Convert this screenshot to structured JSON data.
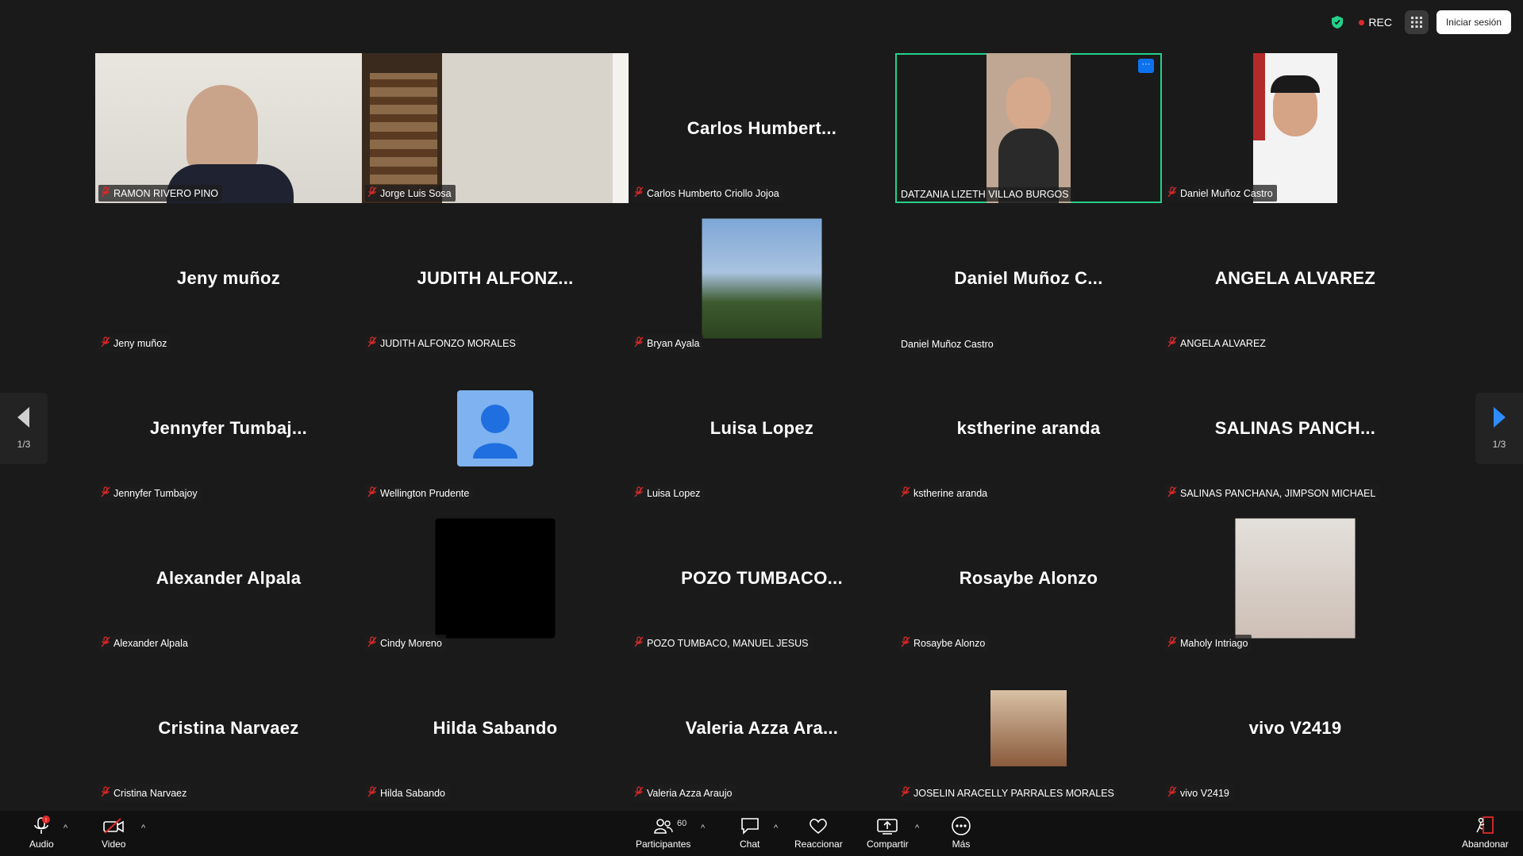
{
  "topbar": {
    "rec_label": "REC",
    "signin_label": "Iniciar sesión",
    "colors": {
      "shield": "#23d18b",
      "rec_dot": "#e02828"
    }
  },
  "pager": {
    "left_page": "1/3",
    "right_page": "1/3"
  },
  "tiles": [
    {
      "label": "RAMON RIVERO PINO",
      "big": "",
      "kind": "video",
      "muted": true
    },
    {
      "label": "Jorge Luis Sosa",
      "big": "",
      "kind": "video",
      "muted": true
    },
    {
      "label": "Carlos Humberto Criollo Jojoa",
      "big": "Carlos  Humbert...",
      "kind": "name",
      "muted": true
    },
    {
      "label": "DATZANIA LIZETH VILLAO BURGOS",
      "big": "",
      "kind": "video",
      "muted": false,
      "active": true
    },
    {
      "label": "Daniel Muñoz Castro",
      "big": "",
      "kind": "video",
      "muted": true
    },
    {
      "label": "Jeny muñoz",
      "big": "Jeny muñoz",
      "kind": "name",
      "muted": true
    },
    {
      "label": "JUDITH ALFONZO MORALES",
      "big": "JUDITH  ALFONZ...",
      "kind": "name",
      "muted": true
    },
    {
      "label": "Bryan Ayala",
      "big": "",
      "kind": "photo",
      "muted": true
    },
    {
      "label": "Daniel Muñoz Castro",
      "big": "Daniel  Muñoz  C...",
      "kind": "name",
      "muted": false
    },
    {
      "label": "ANGELA ALVAREZ",
      "big": "ANGELA ALVAREZ",
      "kind": "name",
      "muted": true
    },
    {
      "label": "Jennyfer Tumbajoy",
      "big": "Jennyfer  Tumbaj...",
      "kind": "name",
      "muted": true
    },
    {
      "label": "Wellington Prudente",
      "big": "",
      "kind": "generic",
      "muted": true
    },
    {
      "label": "Luisa Lopez",
      "big": "Luisa Lopez",
      "kind": "name",
      "muted": true
    },
    {
      "label": "kstherine aranda",
      "big": "kstherine aranda",
      "kind": "name",
      "muted": true
    },
    {
      "label": "SALINAS PANCHANA, JIMPSON MICHAEL",
      "big": "SALINAS  PANCH...",
      "kind": "name",
      "muted": true
    },
    {
      "label": "Alexander Alpala",
      "big": "Alexander Alpala",
      "kind": "name",
      "muted": true
    },
    {
      "label": "Cindy Moreno",
      "big": "",
      "kind": "black",
      "muted": true
    },
    {
      "label": "POZO TUMBACO, MANUEL JESUS",
      "big": "POZO  TUMBACO...",
      "kind": "name",
      "muted": true
    },
    {
      "label": "Rosaybe Alonzo",
      "big": "Rosaybe Alonzo",
      "kind": "name",
      "muted": true
    },
    {
      "label": "Maholy Intriago",
      "big": "",
      "kind": "photo",
      "muted": true
    },
    {
      "label": "Cristina Narvaez",
      "big": "Cristina Narvaez",
      "kind": "name",
      "muted": true
    },
    {
      "label": "Hilda Sabando",
      "big": "Hilda Sabando",
      "kind": "name",
      "muted": true
    },
    {
      "label": "Valeria Azza Araujo",
      "big": "Valeria  Azza  Ara...",
      "kind": "name",
      "muted": true
    },
    {
      "label": "JOSELIN ARACELLY PARRALES MORALES",
      "big": "",
      "kind": "photo-small",
      "muted": true
    },
    {
      "label": "vivo V2419",
      "big": "vivo V2419",
      "kind": "name",
      "muted": true
    }
  ],
  "toolbar": {
    "audio": "Audio",
    "video": "Video",
    "participants": "Participantes",
    "participants_count": "60",
    "chat": "Chat",
    "react": "Reaccionar",
    "share": "Compartir",
    "more": "Más",
    "leave": "Abandonar",
    "colors": {
      "leave": "#e02828",
      "share_green": "#23d18b"
    }
  }
}
